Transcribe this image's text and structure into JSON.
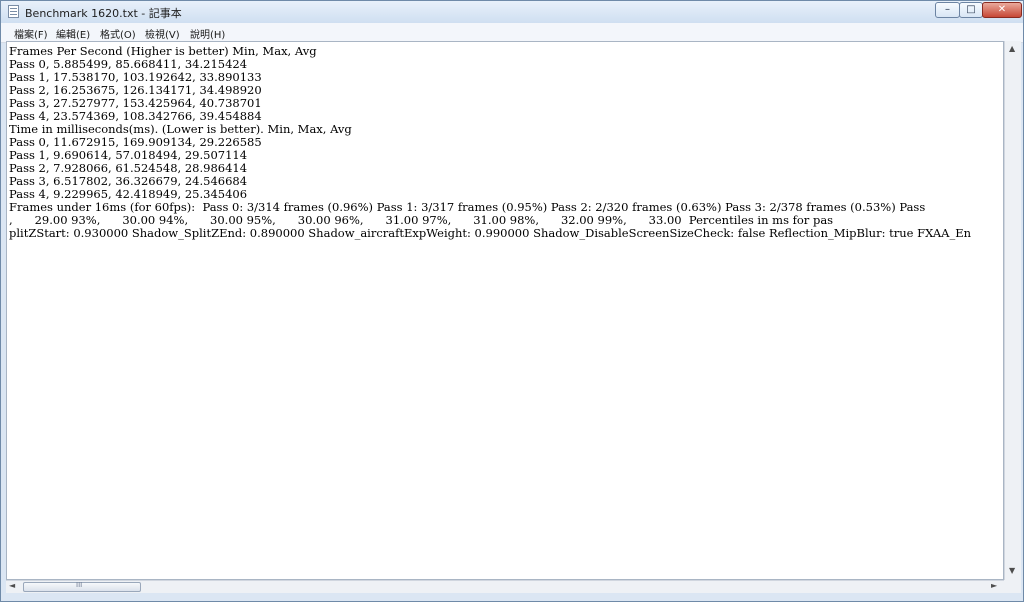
{
  "window": {
    "title": "Benchmark 1620.txt - 記事本",
    "controls": {
      "minimize": "–",
      "maximize": "□",
      "close": "✕"
    }
  },
  "menu": {
    "items": [
      "檔案(F)",
      "編輯(E)",
      "格式(O)",
      "檢視(V)",
      "說明(H)"
    ]
  },
  "document": {
    "lines": [
      "Frames Per Second (Higher is better) Min, Max, Avg",
      "Pass 0, 5.885499, 85.668411, 34.215424",
      "Pass 1, 17.538170, 103.192642, 33.890133",
      "Pass 2, 16.253675, 126.134171, 34.498920",
      "Pass 3, 27.527977, 153.425964, 40.738701",
      "Pass 4, 23.574369, 108.342766, 39.454884",
      "Time in milliseconds(ms). (Lower is better). Min, Max, Avg",
      "Pass 0, 11.672915, 169.909134, 29.226585",
      "Pass 1, 9.690614, 57.018494, 29.507114",
      "Pass 2, 7.928066, 61.524548, 28.986414",
      "Pass 3, 6.517802, 36.326679, 24.546684",
      "Pass 4, 9.229965, 42.418949, 25.345406",
      "Frames under 16ms (for 60fps):  Pass 0: 3/314 frames (0.96%) Pass 1: 3/317 frames (0.95%) Pass 2: 2/320 frames (0.63%) Pass 3: 2/378 frames (0.53%) Pass",
      ",      29.00 93%,      30.00 94%,      30.00 95%,      30.00 96%,      31.00 97%,      31.00 98%,      32.00 99%,      33.00  Percentiles in ms for pas",
      "plitZStart: 0.930000 Shadow_SplitZEnd: 0.890000 Shadow_aircraftExpWeight: 0.990000 Shadow_DisableScreenSizeCheck: false Reflection_MipBlur: true FXAA_En"
    ]
  },
  "scrollbars": {
    "up_arrow": "▲",
    "down_arrow": "▼",
    "left_arrow": "◄",
    "right_arrow": "►",
    "grip": "III"
  }
}
